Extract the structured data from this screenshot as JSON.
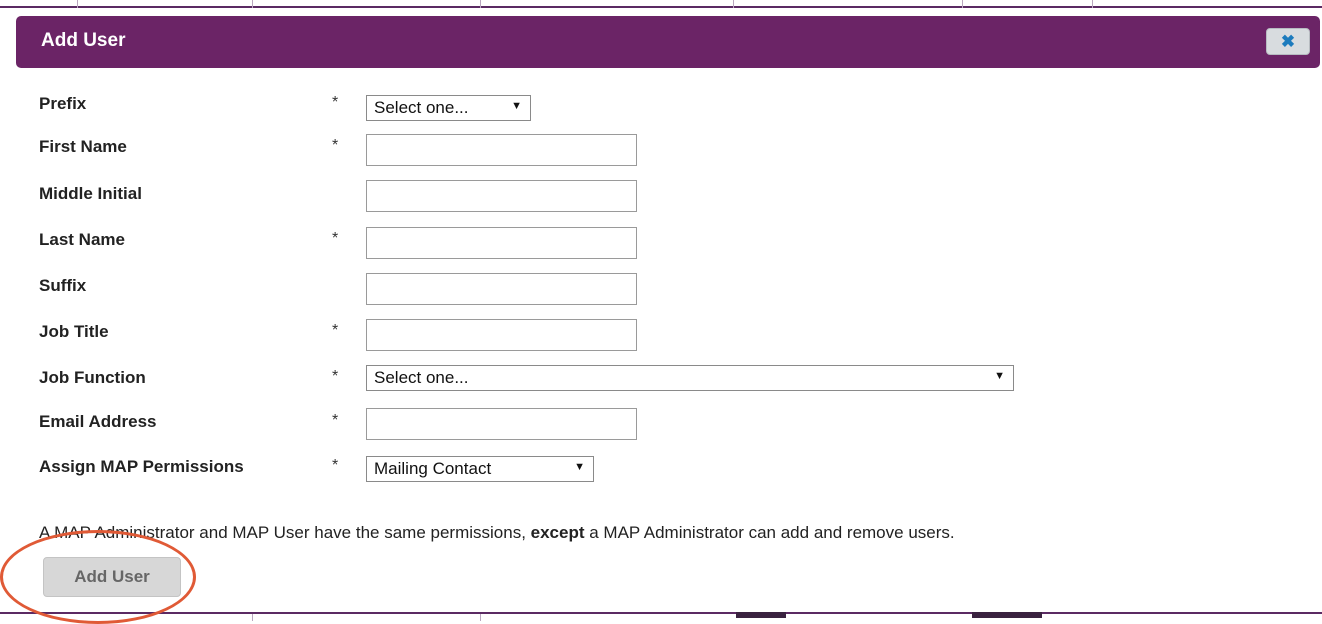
{
  "dialog": {
    "title": "Add User",
    "close_icon": "close-icon",
    "close_glyph": "✖"
  },
  "form": {
    "required_marker": "*",
    "fields": [
      {
        "label": "Prefix",
        "required": true,
        "type": "select",
        "value": "Select one..."
      },
      {
        "label": "First Name",
        "required": true,
        "type": "text",
        "value": ""
      },
      {
        "label": "Middle Initial",
        "required": false,
        "type": "text",
        "value": ""
      },
      {
        "label": "Last Name",
        "required": true,
        "type": "text",
        "value": ""
      },
      {
        "label": "Suffix",
        "required": false,
        "type": "text",
        "value": ""
      },
      {
        "label": "Job Title",
        "required": true,
        "type": "text",
        "value": ""
      },
      {
        "label": "Job Function",
        "required": true,
        "type": "select",
        "value": "Select one..."
      },
      {
        "label": "Email Address",
        "required": true,
        "type": "text",
        "value": ""
      },
      {
        "label": "Assign MAP Permissions",
        "required": true,
        "type": "select",
        "value": "Mailing Contact"
      }
    ],
    "note_part1": "A MAP Administrator and MAP User have the same permissions, ",
    "note_bold": "except",
    "note_part2": " a MAP Administrator can add and remove users.",
    "submit_label": "Add User"
  },
  "colors": {
    "titlebar": "#6b2466",
    "highlight": "#e05a36",
    "close_glyph": "#1c7bbd"
  }
}
